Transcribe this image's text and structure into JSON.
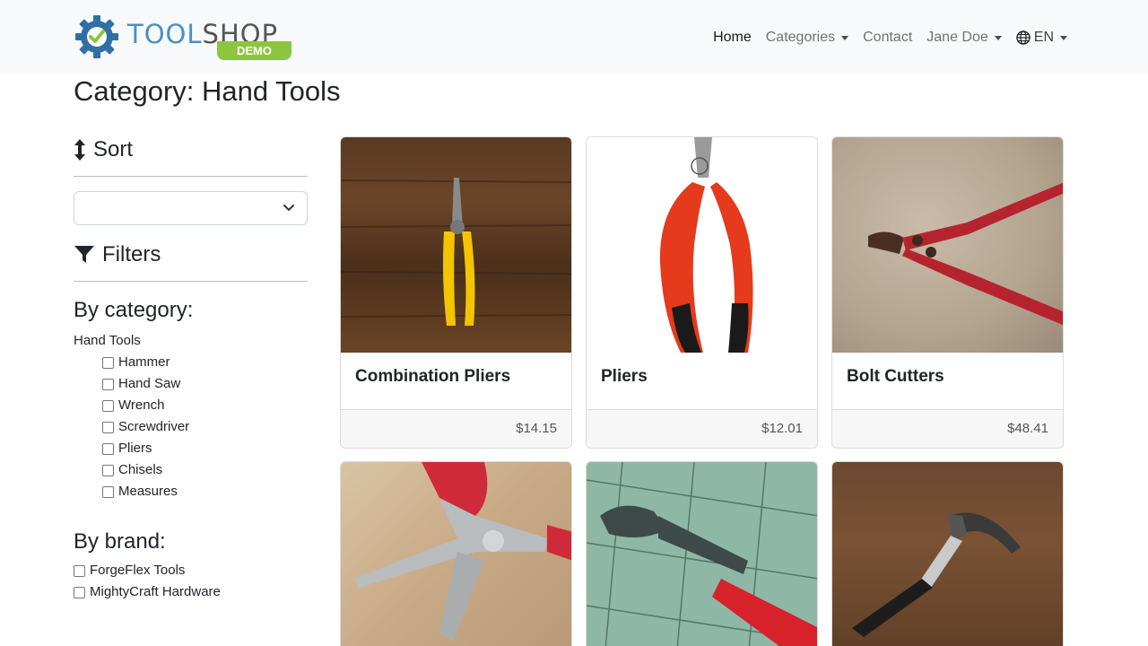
{
  "brand": {
    "part1": "TOOL",
    "part2": "SHOP",
    "badge": "DEMO"
  },
  "nav": {
    "home": "Home",
    "categories": "Categories",
    "contact": "Contact",
    "user": "Jane Doe",
    "language": "EN"
  },
  "page": {
    "title": "Category: Hand Tools"
  },
  "sidebar": {
    "sort_heading": "Sort",
    "sort_value": "",
    "filters_heading": "Filters",
    "by_category": "By category:",
    "root_category": "Hand Tools",
    "categories": [
      "Hammer",
      "Hand Saw",
      "Wrench",
      "Screwdriver",
      "Pliers",
      "Chisels",
      "Measures"
    ],
    "by_brand": "By brand:",
    "brands": [
      "ForgeFlex Tools",
      "MightyCraft Hardware"
    ]
  },
  "products": [
    {
      "name": "Combination Pliers",
      "price": "$14.15"
    },
    {
      "name": "Pliers",
      "price": "$12.01"
    },
    {
      "name": "Bolt Cutters",
      "price": "$48.41"
    },
    {
      "name": "",
      "price": ""
    },
    {
      "name": "",
      "price": ""
    },
    {
      "name": "",
      "price": ""
    }
  ],
  "colors": {
    "brand_blue": "#4a90c2",
    "brand_green": "#8cc63f",
    "navbar_bg": "#f8f9fa"
  }
}
